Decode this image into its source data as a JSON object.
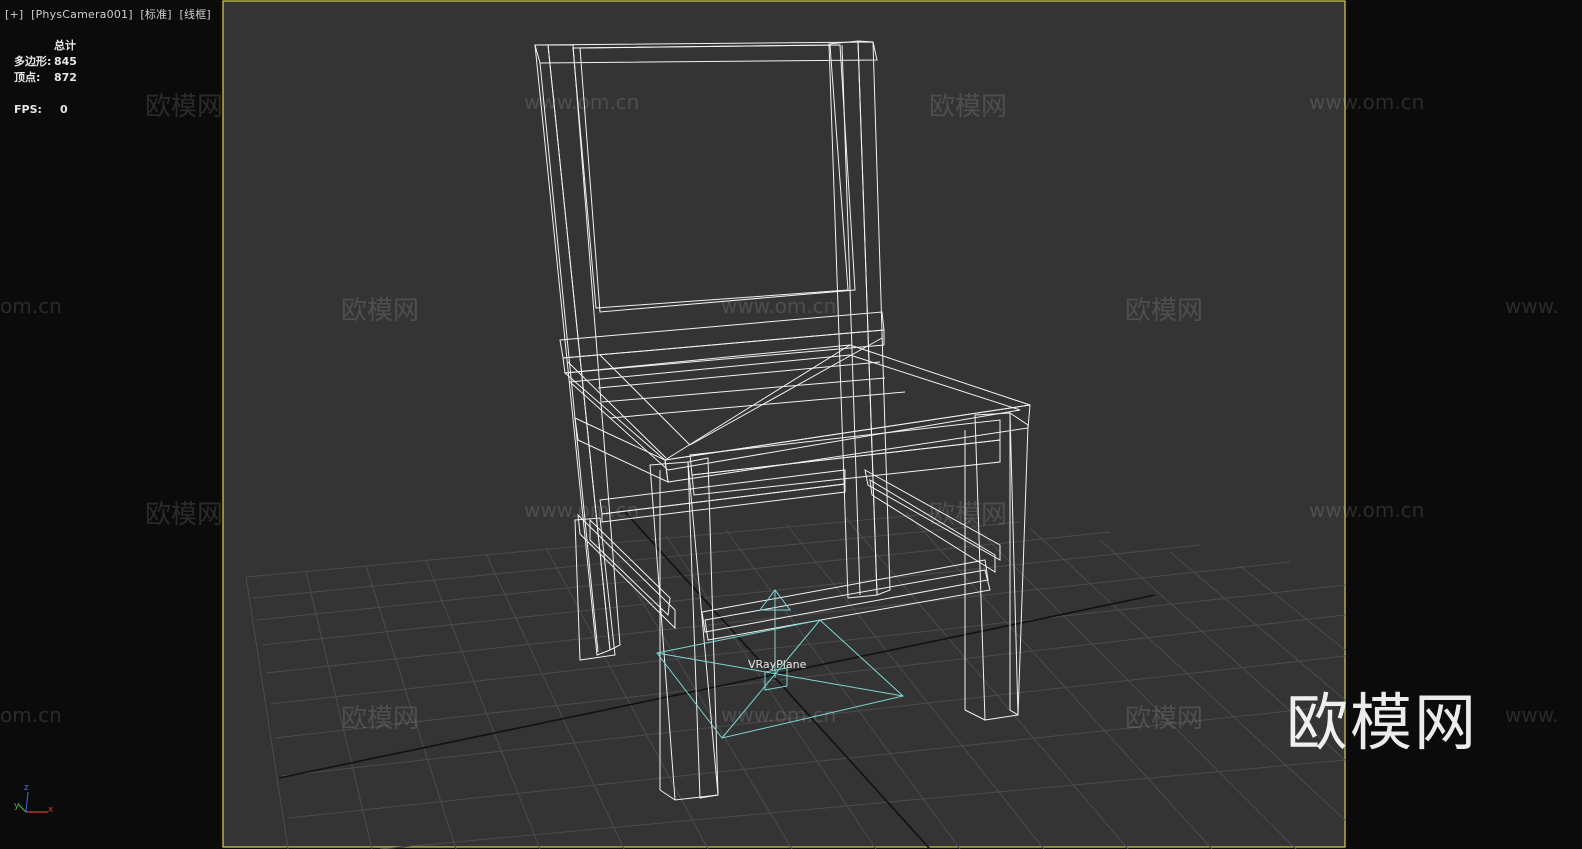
{
  "viewport": {
    "menu_label": "[+]",
    "camera_label": "[PhysCamera001]",
    "shading_label": "[标准]",
    "mode_label": "[线框]"
  },
  "stats": {
    "header": "总计",
    "polygons_label": "多边形:",
    "polygons_value": "845",
    "vertices_label": "顶点:",
    "vertices_value": "872",
    "fps_label": "FPS:",
    "fps_value": "0"
  },
  "scene": {
    "plane_label": "VRayPlane",
    "wire_color": "#ffffff",
    "vray_plane_color": "#7fd6d4",
    "frame_color": "#e4e07a"
  },
  "axis": {
    "x_label": "x",
    "y_label": "y",
    "z_label": "z"
  },
  "watermark": {
    "brand": "欧模网",
    "url": "www.om.cn",
    "url_short": "www.",
    "url_tail": "om.cn"
  }
}
